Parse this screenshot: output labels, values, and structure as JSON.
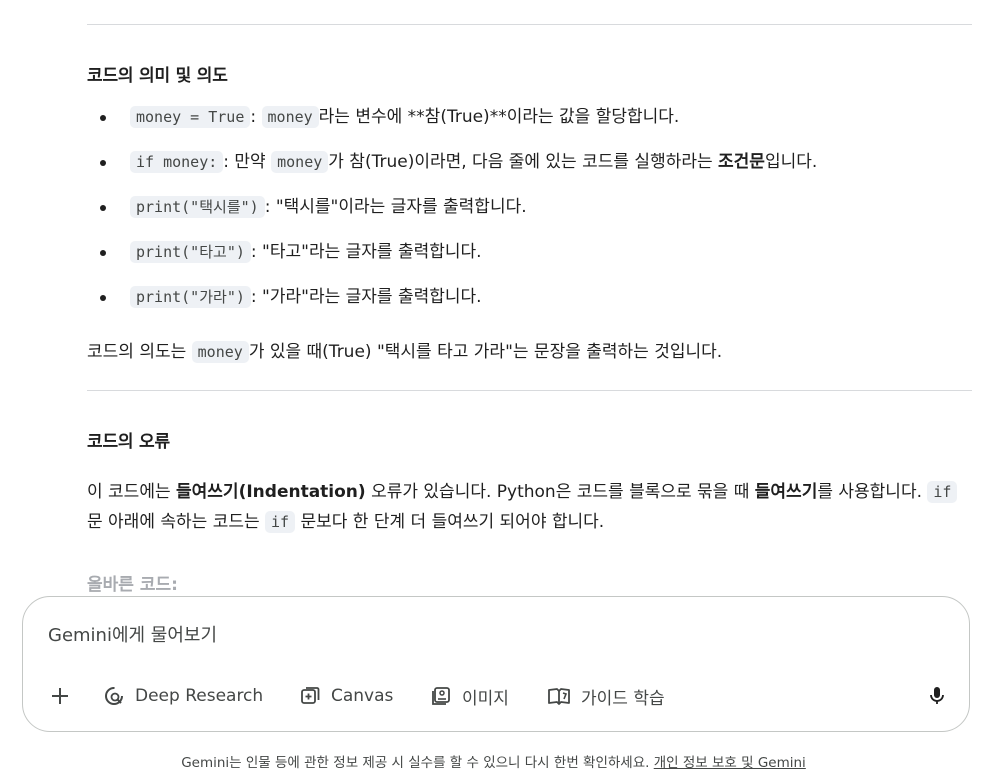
{
  "section_meaning": {
    "heading": "코드의 의미 및 의도",
    "items": [
      {
        "code": "money = True",
        "text": ": ",
        "code2": "money",
        "text2": "라는 변수에 **참(True)**이라는 값을 할당합니다."
      },
      {
        "code": "if money:",
        "text": ": 만약 ",
        "code2": "money",
        "text2": "가 참(True)이라면, 다음 줄에 있는 코드를 실행하라는 ",
        "bold": "조건문",
        "text3": "입니다."
      },
      {
        "code": "print(\"택시를\")",
        "text": ": \"택시를\"이라는 글자를 출력합니다."
      },
      {
        "code": "print(\"타고\")",
        "text": ": \"타고\"라는 글자를 출력합니다."
      },
      {
        "code": "print(\"가라\")",
        "text": ": \"가라\"라는 글자를 출력합니다."
      }
    ],
    "intent_pre": "코드의 의도는 ",
    "intent_code": "money",
    "intent_post": "가 있을 때(True) \"택시를 타고 가라\"는 문장을 출력하는 것입니다."
  },
  "section_error": {
    "heading": "코드의 오류",
    "p1": "이 코드에는 ",
    "b1": "들여쓰기(Indentation)",
    "p2": " 오류가 있습니다. Python은 코드를 블록으로 묶을 때 ",
    "b2": "들여쓰기",
    "p3": "를 사용합니다. ",
    "code1": "if",
    "p4": " 문 아래에 속하는 코드는 ",
    "code2": "if",
    "p5": " 문보다 한 단계 더 들여쓰기 되어야 합니다.",
    "correct_label": "올바른 코드:"
  },
  "composer": {
    "placeholder": "Gemini에게 물어보기",
    "tools": [
      {
        "label": "Deep Research",
        "icon": "deep-research-icon"
      },
      {
        "label": "Canvas",
        "icon": "canvas-icon"
      },
      {
        "label": "이미지",
        "icon": "image-icon"
      },
      {
        "label": "가이드 학습",
        "icon": "guided-learning-icon"
      }
    ]
  },
  "footer": {
    "text": "Gemini는 인물 등에 관한 정보 제공 시 실수를 할 수 있으니 다시 한번 확인하세요. ",
    "link": "개인 정보 보호 및 Gemini"
  }
}
